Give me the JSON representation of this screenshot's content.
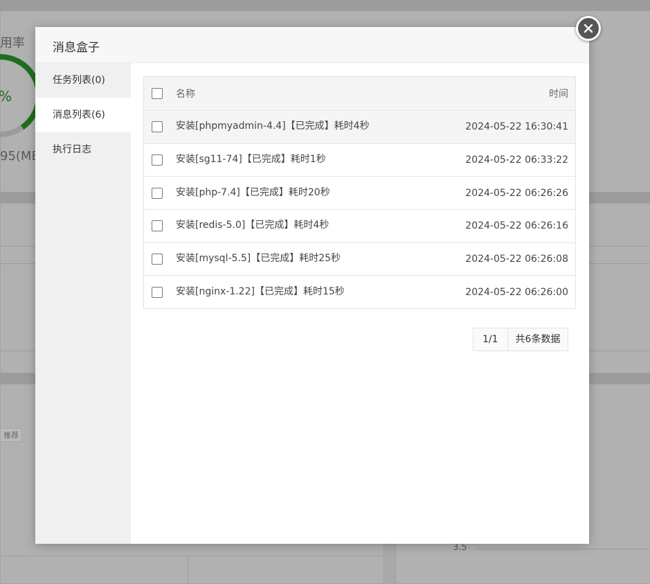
{
  "background": {
    "usage_label": "用率",
    "gauge_percent": "%",
    "mem_text": "95(MB",
    "tag_text": "推荐",
    "axis_tick": "3.5"
  },
  "modal": {
    "title": "消息盒子",
    "sidebar": [
      {
        "label": "任务列表(0)",
        "active": false
      },
      {
        "label": "消息列表(6)",
        "active": true
      },
      {
        "label": "执行日志",
        "active": false
      }
    ],
    "table": {
      "headers": {
        "name": "名称",
        "time": "时间"
      },
      "rows": [
        {
          "name": "安装[phpmyadmin-4.4]【已完成】耗时4秒",
          "time": "2024-05-22 16:30:41"
        },
        {
          "name": "安装[sg11-74]【已完成】耗时1秒",
          "time": "2024-05-22 06:33:22"
        },
        {
          "name": "安装[php-7.4]【已完成】耗时20秒",
          "time": "2024-05-22 06:26:26"
        },
        {
          "name": "安装[redis-5.0]【已完成】耗时4秒",
          "time": "2024-05-22 06:26:16"
        },
        {
          "name": "安装[mysql-5.5]【已完成】耗时25秒",
          "time": "2024-05-22 06:26:08"
        },
        {
          "name": "安装[nginx-1.22]【已完成】耗时15秒",
          "time": "2024-05-22 06:26:00"
        }
      ]
    },
    "pager": {
      "page": "1/1",
      "total": "共6条数据"
    }
  },
  "colors": {
    "overlay": "#a9a9a9",
    "header_bg": "#f7f7f7",
    "sidebar_bg": "#f0f0f0",
    "gauge_green": "#20a53a"
  },
  "icons": {
    "close": "close-icon"
  }
}
